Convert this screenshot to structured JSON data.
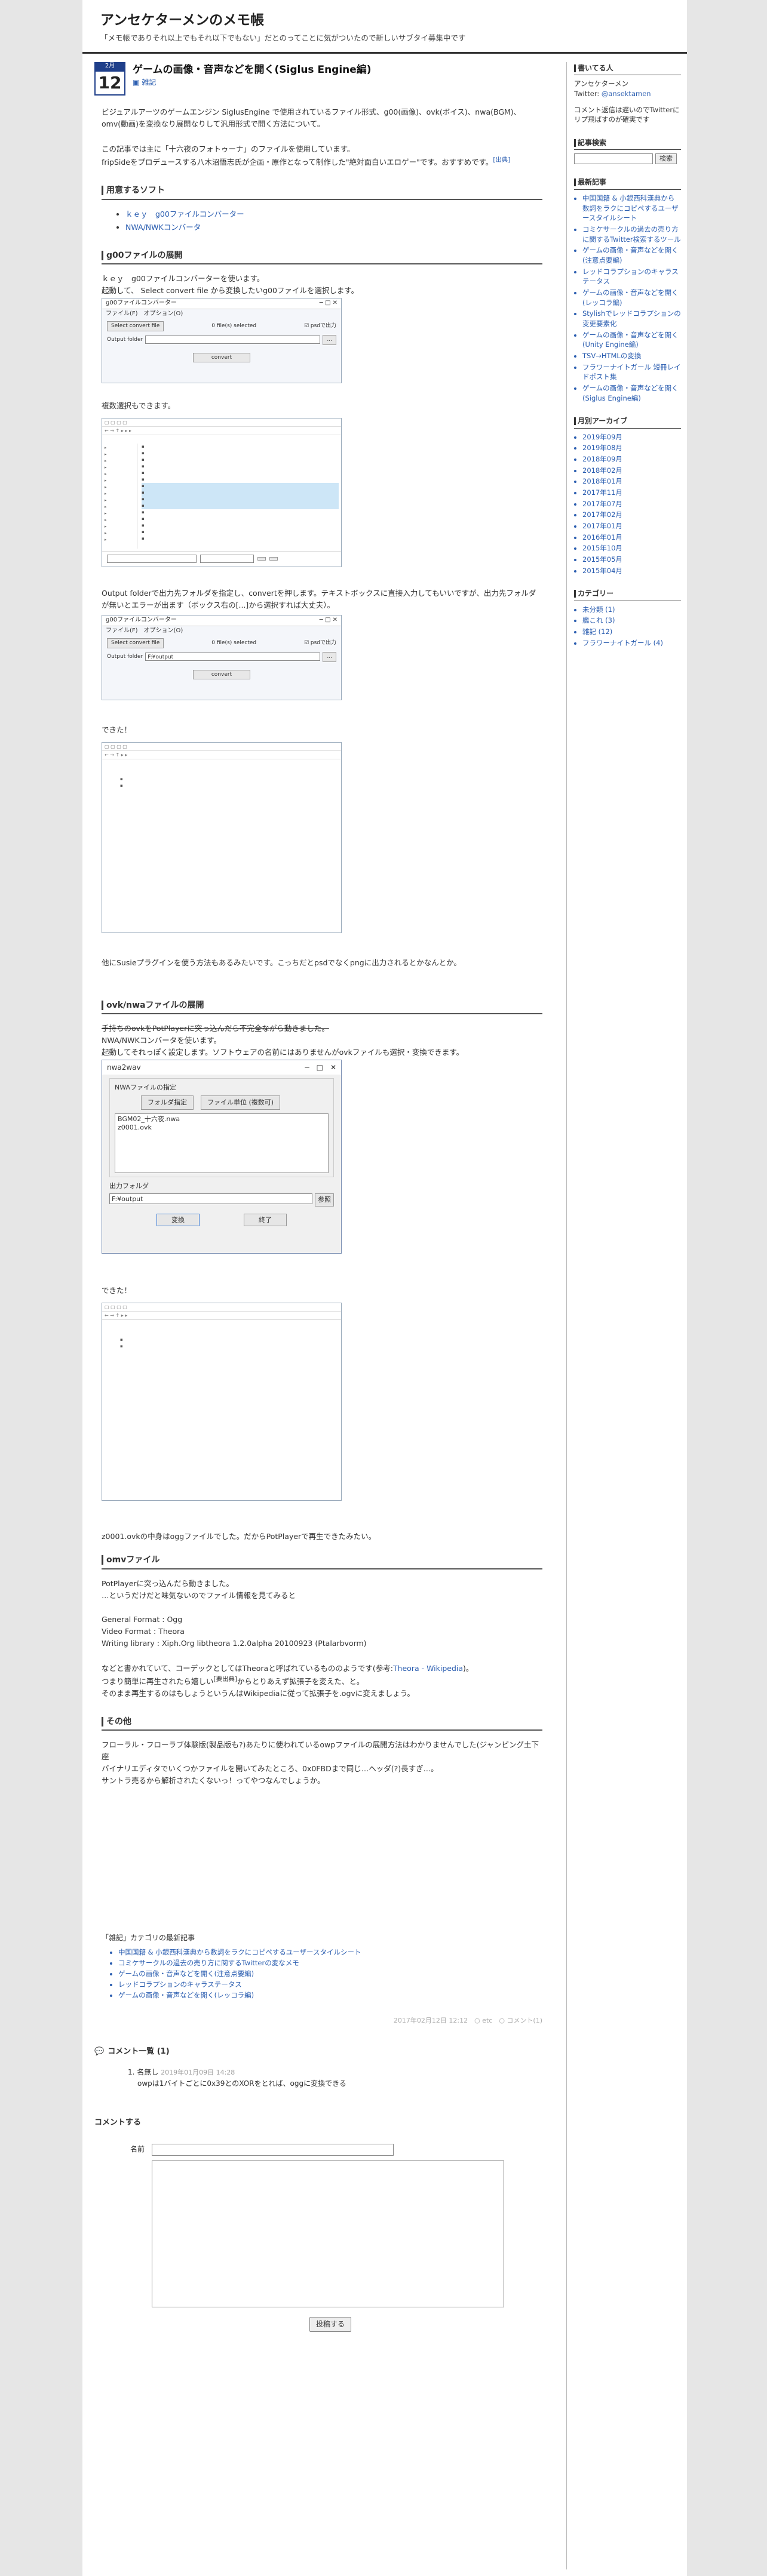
{
  "header": {
    "title": "アンセケターメンのメモ帳",
    "description": "「メモ帳でありそれ以上でもそれ以下でもない」だとのってことに気がついたので新しいサブタイ募集中です"
  },
  "post": {
    "month": "2月",
    "day": "12",
    "title": "ゲームの画像・音声などを開く(Siglus Engine編)",
    "category": "雑記",
    "intro1": "ビジュアルアーツのゲームエンジン SiglusEngine で使用されているファイル形式、g00(画像)、ovk(ボイス)、nwa(BGM)、omv(動画)を変換なり展開なりして汎用形式で開く方法について。",
    "intro2": "この記事では主に「十六夜のフォトゥーナ」のファイルを使用しています。",
    "intro3": "fripSideをプロデュースする八木沼悟志氏が企画・原作となって制作した\"絶対面白いエロゲー\"です。おすすめです。",
    "intro3_link": "[出典]",
    "sections": {
      "soft": "用意するソフト",
      "g00": "g00ファイルの展開",
      "ovk": "ovk/nwaファイルの展開",
      "omv": "omvファイル",
      "other": "その他"
    },
    "soft_links": [
      "ｋｅｙ　g00ファイルコンバーター",
      "NWA/NWKコンバータ"
    ],
    "g00_p1": "ｋｅｙ　g00ファイルコンバーターを使います。",
    "g00_p2": "起動して、 Select convert file から変換したいg00ファイルを選択します。",
    "g00_p3": "複数選択もできます。",
    "g00_p4": "Output folderで出力先フォルダを指定し、convertを押します。テキストボックスに直接入力してもいいですが、出力先フォルダが無いとエラーが出ます（ボックス右の[...]から選択すれば大丈夫）。",
    "g00_p5": "できた！",
    "g00_p6": "他にSusieプラグインを使う方法もあるみたいです。こっちだとpsdでなくpngに出力されるとかなんとか。",
    "g00_window": {
      "title": "g00ファイルコンバーター",
      "menu": "ファイル(F)　オプション(O)",
      "select_btn": "Select convert file",
      "count": "0 file(s) selected",
      "checkbox": "psdで出力",
      "output_label": "Output folder",
      "output_value": "",
      "output_value2": "F:¥output",
      "convert": "convert"
    },
    "ovk_strike": "手持ちのovkをPotPlayerに突っ込んだら不完全ながら動きました。",
    "ovk_p1": "NWA/NWKコンバータを使います。",
    "ovk_p2": "起動してそれっぽく設定します。ソフトウェアの名前にはありませんがovkファイルも選択・変換できます。",
    "nwa_dialog": {
      "title": "nwa2wav",
      "group_label": "NWAファイルの指定",
      "btn_folder": "フォルダ指定",
      "btn_file": "ファイル単位 (複数可)",
      "list": [
        "BGM02_十六夜.nwa",
        "z0001.ovk"
      ],
      "out_label": "出力フォルダ",
      "out_value": "F:¥output",
      "browse": "参照",
      "convert": "変換",
      "exit": "終了"
    },
    "ovk_p3": "できた！",
    "ovk_p4": "z0001.ovkの中身はoggファイルでした。だからPotPlayerで再生できたみたい。",
    "omv_p1": "PotPlayerに突っ込んだら動きました。",
    "omv_p2": "…というだけだと味気ないのでファイル情報を見てみると",
    "omv_p3": "General Format : Ogg",
    "omv_p4": "Video Format : Theora",
    "omv_p5": "Writing library : Xiph.Org libtheora 1.2.0alpha 20100923 (Ptalarbvorm)",
    "omv_p6a": "などと書かれていて、コーデックとしてはTheoraと呼ばれているもののようです(参考:",
    "omv_p6_link": "Theora - Wikipedia",
    "omv_p6b": ")。",
    "omv_p7a": "つまり簡単に再生されたら嬉しい",
    "omv_p7_sup": "[要出典]",
    "omv_p7b": "からとりあえず拡張子を変えた、と。",
    "omv_p8": "そのまま再生するのはもしょうというんはWikipediaに従って拡張子を.ogvに変えましょう。",
    "other_p1": "フローラル・フローラブ体験版(製品版も?)あたりに使われているowpファイルの展開方法はわかりませんでした(ジャンピング土下座",
    "other_p2": "バイナリエディタでいくつかファイルを開いてみたところ、0x0FBDまで同じ…ヘッダ(?)長すぎ…。",
    "other_p3": "サントラ売るから解析されたくないっ！ってやつなんでしょうか。",
    "recent_title": "「雑記」カテゴリの最新記事",
    "recent": [
      "中国国籍 & 小銀西科漢典から数詞をラクにコピペするユーザースタイルシート",
      "コミケサークルの過去の売り方に関するTwitterの変なメモ",
      "ゲームの画像・音声などを開く(注意点要編)",
      "レッドコラプションのキャラステータス",
      "ゲームの画像・音声などを開く(レッコラ編)"
    ],
    "footer": "2017年02月12日 12:12　○ etc　○ コメント(1)"
  },
  "comments": {
    "header": "コメント一覧 (1)",
    "items": [
      {
        "num": "1.",
        "author": "名無し",
        "date": "2019年01月09日 14:28",
        "text": "owpは1バイトごとに0x39とのXORをとれば、oggに変換できる"
      }
    ],
    "form_title": "コメントする",
    "name_label": "名前",
    "submit": "投稿する"
  },
  "sidebar": {
    "author_title": "書いてる人",
    "author_name": "アンセケターメン",
    "author_twitter_label": "Twitter: ",
    "author_twitter": "@ansektamen",
    "author_note": "コメント返信は遅いのでTwitterにリプ飛ばすのが確実です",
    "search_title": "記事検索",
    "search_btn": "検索",
    "latest_title": "最新記事",
    "latest": [
      "中国国籍 & 小銀西科漢典から数詞をラクにコピペするユーザースタイルシート",
      "コミケサークルの過去の売り方に関するTwitter検索するツール",
      "ゲームの画像・音声などを開く(注意点要編)",
      "レッドコラプションのキャラステータス",
      "ゲームの画像・音声などを開く(レッコラ編)",
      "Stylishでレッドコラプションの変更要素化",
      "ゲームの画像・音声などを開く(Unity Engine編)",
      "TSV→HTMLの変換",
      "フラワーナイトガール 短冊レイドポスト集",
      "ゲームの画像・音声などを開く(Siglus Engine編)"
    ],
    "archive_title": "月別アーカイブ",
    "archive": [
      "2019年09月",
      "2019年08月",
      "2018年09月",
      "2018年02月",
      "2018年01月",
      "2017年11月",
      "2017年07月",
      "2017年02月",
      "2017年01月",
      "2016年01月",
      "2015年10月",
      "2015年05月",
      "2015年04月"
    ],
    "cat_title": "カテゴリー",
    "cats": [
      "未分類 (1)",
      "艦これ (3)",
      "雑記 (12)",
      "フラワーナイトガール (4)"
    ]
  }
}
